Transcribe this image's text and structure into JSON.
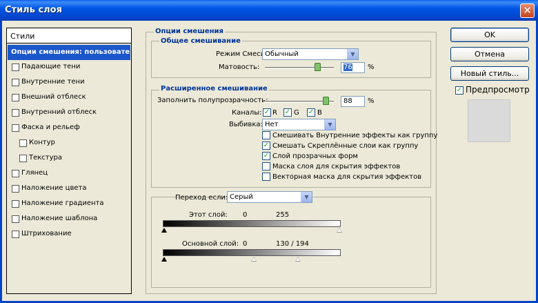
{
  "window": {
    "title": "Стиль слоя",
    "close_glyph": "✕"
  },
  "styles_panel": {
    "header": "Стили",
    "items": [
      {
        "label": "Опции смешения: пользовательс",
        "checkbox": false,
        "selected": true
      },
      {
        "label": "Падающие тени",
        "checkbox": true,
        "checked": false
      },
      {
        "label": "Внутренние тени",
        "checkbox": true,
        "checked": false
      },
      {
        "label": "Внешний отблеск",
        "checkbox": true,
        "checked": false
      },
      {
        "label": "Внутренний отблеск",
        "checkbox": true,
        "checked": false
      },
      {
        "label": "Фаска и рельеф",
        "checkbox": true,
        "checked": false
      },
      {
        "label": "Контур",
        "checkbox": true,
        "checked": false,
        "indent": true
      },
      {
        "label": "Текстура",
        "checkbox": true,
        "checked": false,
        "indent": true
      },
      {
        "label": "Глянец",
        "checkbox": true,
        "checked": false
      },
      {
        "label": "Наложение цвета",
        "checkbox": true,
        "checked": false
      },
      {
        "label": "Наложение градиента",
        "checkbox": true,
        "checked": false
      },
      {
        "label": "Наложение шаблона",
        "checkbox": true,
        "checked": false
      },
      {
        "label": "Штрихование",
        "checkbox": true,
        "checked": false
      }
    ]
  },
  "blending": {
    "title": "Опции смешения",
    "general": {
      "title": "Общее смешивание",
      "mode_label": "Режим Смеси:",
      "mode_value": "Обычный",
      "opacity_label": "Матовость:",
      "opacity_value": "76",
      "opacity_percent": 0.76,
      "percent": "%"
    },
    "advanced": {
      "title": "Расширенное смешивание",
      "fill_label": "Заполнить полупрозрачность:",
      "fill_value": "88",
      "fill_percent": 0.88,
      "percent": "%",
      "channels_label": "Каналы:",
      "channel_r": "R",
      "channel_g": "G",
      "channel_b": "B",
      "knockout_label": "Выбивка:",
      "knockout_value": "Нет",
      "options": [
        {
          "label": "Смешивать Внутренние эффекты как группу",
          "checked": false
        },
        {
          "label": "Смешать Скреплённые слои как группу",
          "checked": true
        },
        {
          "label": "Слой прозрачных форм",
          "checked": true
        },
        {
          "label": "Маска слоя для скрытия эффектов",
          "checked": false
        },
        {
          "label": "Векторная маска для скрытия эффектов",
          "checked": false
        }
      ]
    },
    "blend_if": {
      "label": "Переход если:",
      "value": "Серый",
      "this_layer_label": "Этот слой:",
      "this_layer_min": "0",
      "this_layer_max": "255",
      "underlying_label": "Основной слой:",
      "underlying_min": "0",
      "underlying_max": "130 / 194",
      "underlying_split_low": 130,
      "underlying_split_high": 194
    }
  },
  "buttons": {
    "ok": "OK",
    "cancel": "Отмена",
    "new_style": "Новый стиль...",
    "preview_label": "Предпросмотр",
    "preview_checked": true
  },
  "check_glyph": "✓",
  "arrow_glyph": "▼"
}
